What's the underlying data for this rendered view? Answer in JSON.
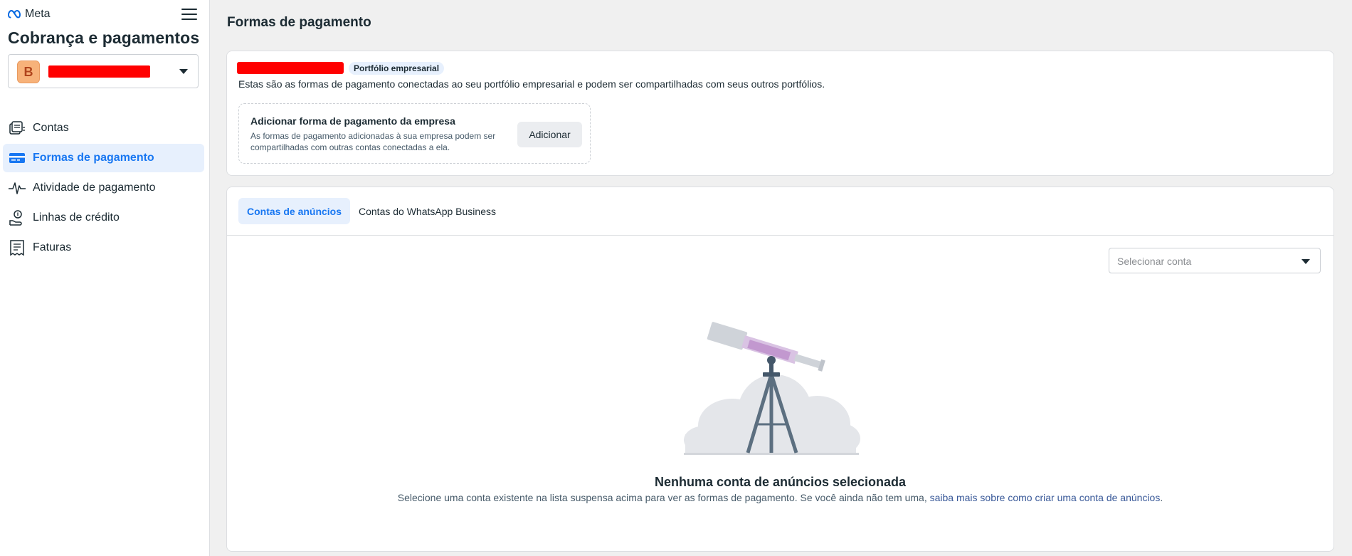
{
  "brand": {
    "name": "Meta"
  },
  "sidebar": {
    "title": "Cobrança e pagamentos",
    "account": {
      "avatar_letter": "B"
    },
    "items": [
      {
        "label": "Contas",
        "icon": "accounts-icon"
      },
      {
        "label": "Formas de pagamento",
        "icon": "credit-card-icon",
        "active": true
      },
      {
        "label": "Atividade de pagamento",
        "icon": "activity-icon"
      },
      {
        "label": "Linhas de crédito",
        "icon": "credit-line-icon"
      },
      {
        "label": "Faturas",
        "icon": "invoice-icon"
      }
    ]
  },
  "page": {
    "title": "Formas de pagamento"
  },
  "business": {
    "badge": "Portfólio empresarial",
    "description": "Estas são as formas de pagamento conectadas ao seu portfólio empresarial e podem ser compartilhadas com seus outros portfólios.",
    "add_box": {
      "title": "Adicionar forma de pagamento da empresa",
      "subtitle": "As formas de pagamento adicionadas à sua empresa podem ser compartilhadas com outras contas conectadas a ela.",
      "button": "Adicionar"
    }
  },
  "tabs": [
    {
      "label": "Contas de anúncios",
      "active": true
    },
    {
      "label": "Contas do WhatsApp Business",
      "active": false
    }
  ],
  "account_select": {
    "placeholder": "Selecionar conta"
  },
  "empty_state": {
    "title": "Nenhuma conta de anúncios selecionada",
    "description": "Selecione uma conta existente na lista suspensa acima para ver as formas de pagamento. Se você ainda não tem uma, ",
    "link": "saiba mais sobre como criar uma conta de anúncios",
    "suffix": "."
  },
  "colors": {
    "accent": "#1877f2",
    "active_bg": "#e7f0fd",
    "redaction": "#ff0000",
    "background": "#f0f0f0"
  }
}
